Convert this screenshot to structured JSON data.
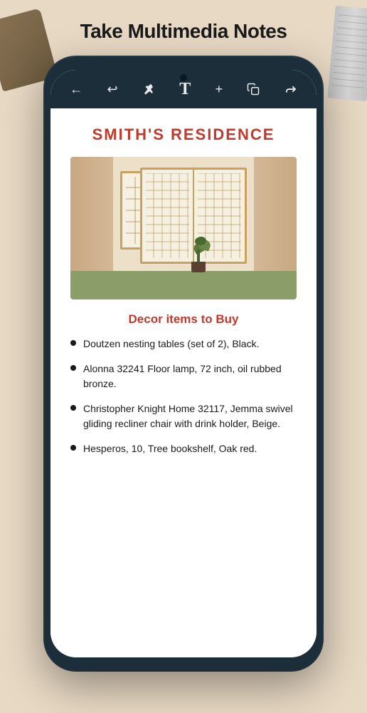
{
  "page": {
    "title": "Take Multimedia Notes"
  },
  "toolbar": {
    "back_icon": "←",
    "undo_icon": "↩",
    "pin_icon": "📌",
    "text_icon": "T",
    "add_icon": "+",
    "copy_icon": "⧉",
    "share_icon": "<"
  },
  "note": {
    "title": "SMITH'S RESIDENCE",
    "section_heading": "Decor items to Buy",
    "items": [
      "Doutzen nesting tables (set of 2), Black.",
      "Alonna 32241 Floor lamp, 72 inch, oil rubbed bronze.",
      "Christopher Knight Home  32117, Jemma swivel gliding recliner chair with drink holder, Beige.",
      "Hesperos, 10, Tree bookshelf, Oak red."
    ]
  }
}
